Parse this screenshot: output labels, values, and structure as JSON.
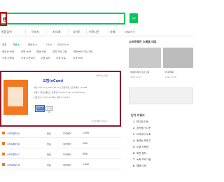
{
  "search": {
    "query": "캠",
    "button_label": "검색"
  },
  "tabs": [
    "통합검색",
    "이미지",
    "지식iN",
    "사이트",
    "어학사전",
    "카페",
    "더보기 ▾"
  ],
  "filters": {
    "row1": [
      "정렬",
      "기본 ▾",
      "용량순 ▾",
      "OS ▾",
      "라이선스 ▾"
    ],
    "row2": [
      "동영상 녹화",
      "화면 녹화",
      "웹캠 녹화",
      "캡처 프로그램",
      "화면녹화 프로그램"
    ],
    "row3": [
      "오캠 사용법",
      "오캠 다운로드",
      "오캠 설치",
      "오캠 무료",
      "오캠 녹화"
    ]
  },
  "result": {
    "more_link": "바이러스 검사",
    "title": "오캠(oCam)",
    "meta1": "버전 v537.0  |  2019.10.14  |  한글지원  |  프리웨어  |  12MB",
    "meta2": "개발사 명정보통신  |  등록일 2019.10.14  |  OS Windows",
    "meta3": "다운로드 1,307,123회  |  평점 ★★★★☆",
    "dl_button": "다운로드",
    "dl_button2": "공식사이트",
    "bottom_link": "소프트웨어 더보기 ›"
  },
  "list_rows": [
    {
      "name": "소프트웨어 A",
      "lang": "한글",
      "license": "프리웨어",
      "size": "11MB"
    },
    {
      "name": "소프트웨어 B",
      "lang": "한글",
      "license": "셰어웨어",
      "size": "9MB"
    },
    {
      "name": "소프트웨어 C",
      "lang": "한글",
      "license": "프리웨어",
      "size": "6MB"
    },
    {
      "name": "소프트웨어 D",
      "lang": "한글",
      "license": "셰어웨어",
      "size": "14MB"
    }
  ],
  "side": {
    "title": "소프트웨어 스페셜 리뷰",
    "cap1": "무료PC정리 프로그램",
    "date1": "2019.10.11",
    "cap2": "PC최적화",
    "date2": "2019.10.08",
    "keywords_title": "인기 키워드",
    "keywords": [
      "반디캠 다운",
      "곰녹음기 다운",
      "브라우저 녹화",
      "동영상 편집기",
      "오캠 사용법",
      "화면 캡처",
      "녹화 프로그램",
      "웹캠 다운"
    ]
  },
  "colors": {
    "brand": "#03c75a",
    "highlight": "#8b1a2c",
    "thumb": "#f47820"
  }
}
